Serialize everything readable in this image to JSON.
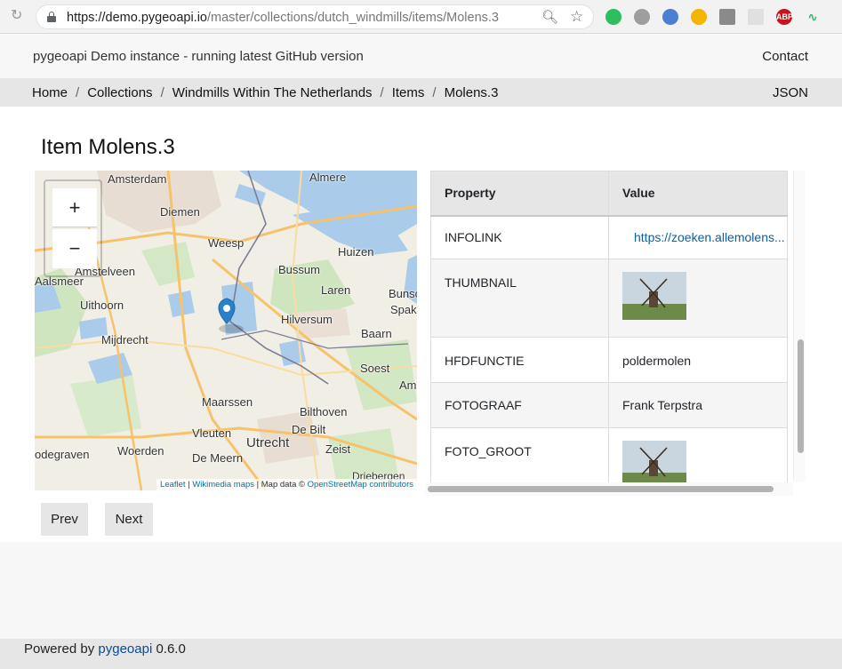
{
  "browser": {
    "url_host": "https://demo.pygeoapi.io",
    "url_path": "/master/collections/dutch_windmills/items/Molens.3"
  },
  "header": {
    "title": "pygeoapi Demo instance - running latest GitHub version",
    "contact": "Contact"
  },
  "breadcrumb": {
    "items": [
      "Home",
      "Collections",
      "Windmills Within The Netherlands",
      "Items",
      "Molens.3"
    ],
    "separator": "/",
    "json": "JSON"
  },
  "page": {
    "title": "Item Molens.3"
  },
  "map": {
    "zoom_in": "+",
    "zoom_out": "−",
    "labels": [
      "Amsterdam",
      "Almere",
      "Diemen",
      "Weesp",
      "Amstelveen",
      "Huizen",
      "Bussum",
      "Aalsmeer",
      "Uithoorn",
      "Laren",
      "Bunsc",
      "Spako",
      "Hilversum",
      "Mijdrecht",
      "Baarn",
      "Soest",
      "Am",
      "Maarssen",
      "Bilthoven",
      "De Bilt",
      "Vleuten",
      "Utrecht",
      "Zeist",
      "odegraven",
      "Woerden",
      "De Meern",
      "Driebergen"
    ],
    "attribution": {
      "leaflet": "Leaflet",
      "sep": " | ",
      "wikimedia": "Wikimedia maps",
      "mapdata": " | Map data © ",
      "osm": "OpenStreetMap contributors"
    }
  },
  "table": {
    "headers": [
      "Property",
      "Value"
    ],
    "rows": [
      {
        "property": "INFOLINK",
        "value": "https://zoeken.allemolens..."
      },
      {
        "property": "THUMBNAIL",
        "value": ""
      },
      {
        "property": "HFDFUNCTIE",
        "value": "poldermolen"
      },
      {
        "property": "FOTOGRAAF",
        "value": "Frank Terpstra"
      },
      {
        "property": "FOTO_GROOT",
        "value": ""
      }
    ]
  },
  "pager": {
    "prev": "Prev",
    "next": "Next"
  },
  "footer": {
    "prefix": "Powered by ",
    "link": "pygeoapi",
    "version": " 0.6.0"
  },
  "colors": {
    "link": "#0b5fa5",
    "marker": "#2a81cb",
    "water": "#a9cbe8",
    "band": "#e6e6e6"
  }
}
